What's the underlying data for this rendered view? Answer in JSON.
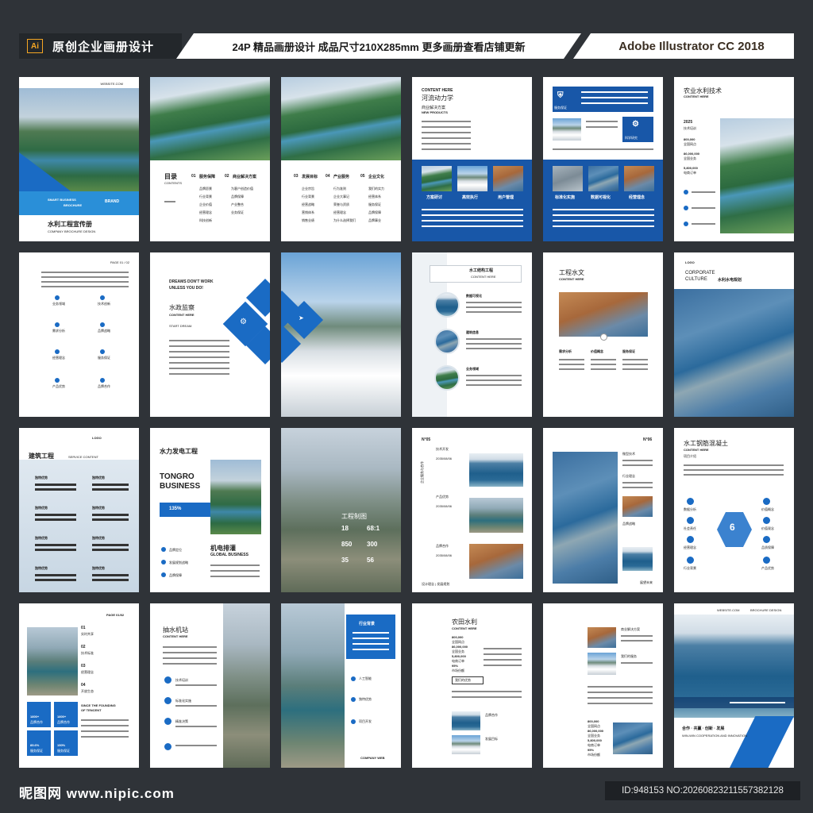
{
  "banner": {
    "ai_badge": "Ai",
    "left_text": "原创企业画册设计",
    "middle_text": "24P 精品画册设计 成品尺寸210X285mm 更多画册查看店铺更新",
    "right_text": "Adobe Illustrator CC 2018"
  },
  "pages": {
    "p1": {
      "website": "WEBSITE.COM",
      "smart": "SMART BUSINESS",
      "brochure": "BROCHURE",
      "brand": "BRAND",
      "title": "水利工程宣传册",
      "subtitle": "COMPANY BROCHURE DESIGN"
    },
    "p3": {
      "toc_title": "目录",
      "toc_en": "CONTENTS",
      "sections": [
        {
          "num": "01",
          "label": "服务保障",
          "items": [
            "品牌愿景",
            "行业背景",
            "企业价值",
            "经营理念",
            "科技创新"
          ]
        },
        {
          "num": "02",
          "label": "商业解决方案",
          "items": [
            "为客户创造价值",
            "品牌保障",
            "产业整合",
            "业务保证"
          ]
        },
        {
          "num": "03",
          "label": "发展目标",
          "items": [
            "企业宗旨",
            "行业背景",
            "经营战略",
            "营销体系",
            "销售业绩"
          ]
        },
        {
          "num": "04",
          "label": "产业服务",
          "items": [
            "行为准则",
            "企业大事记",
            "荣誉与资质",
            "经营理念",
            "为什么选择我们"
          ]
        },
        {
          "num": "05",
          "label": "企业文化",
          "items": [
            "我们的实力",
            "经营体系",
            "服务保证",
            "品牌保障",
            "品牌事业"
          ]
        }
      ]
    },
    "p4": {
      "content": "CONTENT HERE",
      "title": "河流动力学",
      "sub1": "商业解决方案",
      "sub2": "NEW PRODUCTS",
      "caps": [
        "方案研讨",
        "高效执行",
        "用户管理"
      ],
      "cap_en": "NEW PRODUCTS"
    },
    "p5": {
      "label1": "服务保证",
      "label2": "科学研究",
      "caps": [
        "标准化实施",
        "数据可视化",
        "经营理念"
      ],
      "cap_en": "NEW PRODUCTS"
    },
    "p6": {
      "title": "农业水利技术",
      "content": "CONTENT HERE",
      "year": "2025",
      "sub": "技术培训",
      "stats": [
        "800,000",
        "全国网点",
        "86,000,000",
        "全国业务",
        "5,800,000",
        "电商订单"
      ]
    },
    "p7": {
      "page": "PAGE 01 / 02",
      "items": [
        "业务领域",
        "技术创新",
        "需求分析",
        "品牌战略",
        "经营理念",
        "服务保证",
        "产品优势",
        "品牌合作"
      ]
    },
    "p8": {
      "line1": "DREAMS DON'T WORK",
      "line2": "UNLESS YOU DO!",
      "title": "水政监察",
      "content": "CONTENT HERE",
      "start": "START DREAM."
    },
    "p10": {
      "title": "水工结构工程",
      "content": "CONTENT HERE",
      "items": [
        "数据可视化",
        "建筑信息",
        "业务领域"
      ]
    },
    "p11": {
      "title": "工程水文",
      "content": "CONTENT HERE",
      "cols": [
        "需求分析",
        "价值概念",
        "服务保证"
      ]
    },
    "p12": {
      "logo": "LOGO",
      "corp": "CORPORATE",
      "culture": "CULTURE",
      "title": "水利水电规划"
    },
    "p13": {
      "title": "建筑工程",
      "logo": "LOGO",
      "service": "SERVICE CONTENT",
      "label": "独特优势"
    },
    "p14": {
      "title": "水力发电工程",
      "big1": "TONGRO",
      "big2": "BUSINESS",
      "percent": "135%",
      "sub": "机电排灌",
      "global": "GLOBAL BUSINESS",
      "items": [
        "品牌定位",
        "发展规划战略",
        "品牌保障"
      ]
    },
    "p15": {
      "title": "工程制图",
      "nums": [
        "18",
        "68:1",
        "850",
        "300",
        "35",
        "56"
      ]
    },
    "p16": {
      "no": "N°05",
      "vertical": "企业服务与合作",
      "dates": [
        "2035/08/06",
        "2035/08/06",
        "2035/08/06"
      ],
      "labels": [
        "技术开发",
        "产品优势",
        "品牌合作"
      ],
      "foot": "设计理念 | 发展规划"
    },
    "p17": {
      "no": "N°06",
      "labels": [
        "微型技术",
        "行业理念",
        "品牌战略"
      ],
      "foot": "展望未来"
    },
    "p18": {
      "title": "水工钢筋混凝土",
      "content": "CONTENT HERE",
      "sub": "项目介绍",
      "center": "6",
      "left": [
        "数据分析",
        "社会责任",
        "经营理念",
        "行业背景"
      ],
      "right": [
        "价值概念",
        "价值观念",
        "品质保障",
        "产品优势"
      ]
    },
    "p19": {
      "page": "PAGE 01/02",
      "nums": [
        "01",
        "02",
        "03",
        "04"
      ],
      "labels": [
        "实时共享",
        "技术标准",
        "经营理念",
        "开放生态"
      ],
      "since": "SINCE THE FOUNDING",
      "tencent": "OF TENCENT",
      "stats": [
        "1800+",
        "1800+",
        "85.6%",
        "150%"
      ],
      "stat_labels": [
        "品牌合作",
        "品牌合作",
        "服务保证",
        "服务保证"
      ]
    },
    "p20": {
      "title": "抽水机站",
      "content": "CONTENT HERE",
      "items": [
        "技术培训",
        "标准化实施",
        "精准决策"
      ]
    },
    "p22": {
      "title": "行业背景",
      "items": [
        "人工智能",
        "独特优势",
        "项目开发"
      ],
      "company": "COMPANY WEB"
    },
    "p23": {
      "title": "农田水利",
      "content": "CONTENT HERE",
      "stats": [
        "800,000",
        "全国网点",
        "86,000,000",
        "全国业务",
        "5,800,000",
        "电商订单",
        "95%",
        "市场份额"
      ],
      "badge": "我们的优势",
      "labels": [
        "品牌合作",
        "经营理念",
        "发展目标"
      ]
    },
    "p24": {
      "labels": [
        "商业解决方案",
        "我们的服务"
      ],
      "stats": [
        "800,000",
        "全国网点",
        "86,000,000",
        "全国业务",
        "5,800,000",
        "电商订单",
        "95%",
        "市场份额"
      ]
    },
    "p25": {
      "website": "WEBSITE.COM",
      "brochure": "BROCHURE DESIGN",
      "slogan": "合作 · 共赢 · 创新 · 发展",
      "sub": "WIN-WIN COOPERATION AND INNOVATION"
    }
  },
  "footer": {
    "logo": "昵图网 www.nipic.com",
    "id": "ID:948153 NO:20260823211557382128"
  }
}
